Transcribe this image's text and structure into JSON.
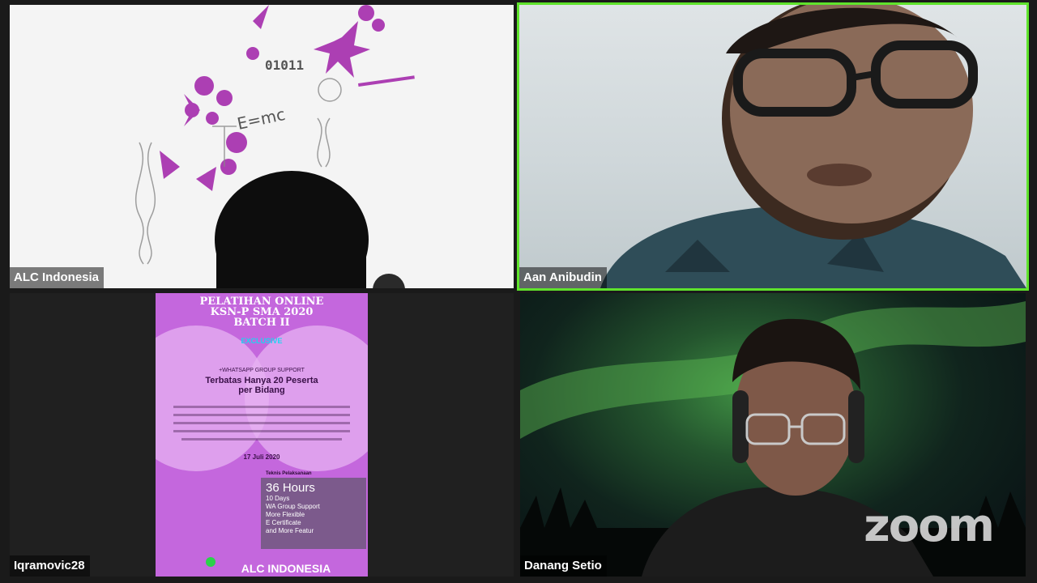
{
  "participants": [
    {
      "name": "ALC Indonesia"
    },
    {
      "name": "Aan Anibudin",
      "active_speaker": true
    },
    {
      "name": "Iqramovic28"
    },
    {
      "name": "Danang Setio"
    }
  ],
  "shared_poster": {
    "title_lines": [
      "PELATIHAN ONLINE",
      "KSN-P SMA 2020",
      "BATCH II"
    ],
    "exclusive": "EXCLUSIVE",
    "support": "+WHATSAPP GROUP SUPPORT",
    "headline_lines": [
      "Terbatas Hanya 20 Peserta",
      "per Bidang"
    ],
    "date": "17 Juli 2020",
    "box_title": "Teknis Pelaksanaan",
    "hours": "36 Hours",
    "box_lines": [
      "10 Days",
      "WA Group Support",
      "More Flexible",
      "E Certificate",
      "and More Featur"
    ],
    "brand": "ALC INDONESIA"
  },
  "watermark": "zoom",
  "colors": {
    "active_border": "#5fe32c",
    "poster_bg": "#c467dd"
  }
}
